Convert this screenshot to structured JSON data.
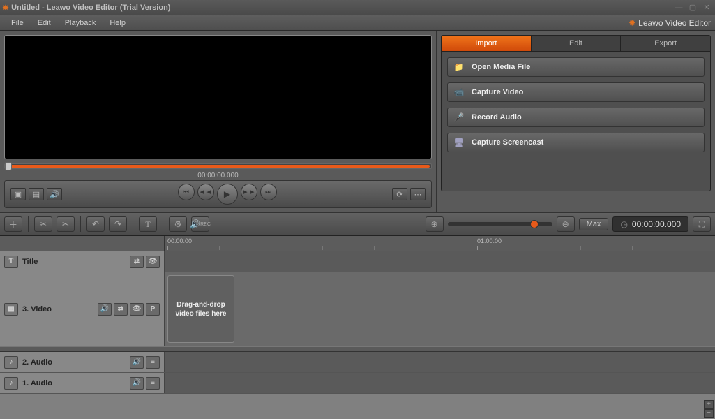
{
  "window": {
    "title": "Untitled - Leawo Video Editor (Trial Version)"
  },
  "menu": {
    "file": "File",
    "edit": "Edit",
    "playback": "Playback",
    "help": "Help",
    "brand": "Leawo Video Editor"
  },
  "preview": {
    "timecode": "00:00:00.000"
  },
  "tabs": {
    "import": "Import",
    "edit": "Edit",
    "export": "Export"
  },
  "import_actions": {
    "open_media": "Open Media File",
    "capture_video": "Capture Video",
    "record_audio": "Record Audio",
    "capture_screencast": "Capture Screencast"
  },
  "toolbar": {
    "max": "Max",
    "counter": "00:00:00.000"
  },
  "ruler": {
    "t0": "00:00:00",
    "t1": "01:00:00"
  },
  "tracks": {
    "title": "Title",
    "video": "3. Video",
    "audio2": "2. Audio",
    "audio1": "1. Audio",
    "drop_hint": "Drag-and-drop video files here",
    "p_label": "P"
  }
}
